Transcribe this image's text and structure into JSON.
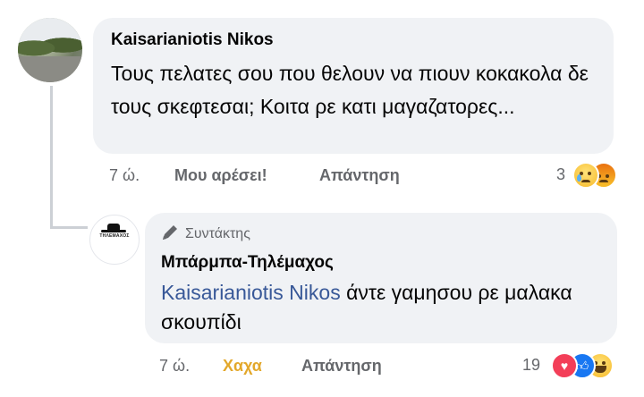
{
  "comment": {
    "author": "Kaisarianiotis Nikos",
    "text": "Τους πελατες σου που θελουν να πιουν κοκακολα δε τους σκεφτεσαι; Κοιτα ρε κατι μαγαζατορες...",
    "time": "7 ώ.",
    "like_label": "Μου αρέσει!",
    "reply_label": "Απάντηση",
    "reaction_count": "3",
    "reactions": [
      "sad-icon",
      "angry-icon"
    ]
  },
  "reply": {
    "badge": "Συντάκτης",
    "author": "Μπάρμπα-Τηλέμαχος",
    "avatar_text": "ΤΗΛΕΜΑΧΟΣ",
    "mention": "Kaisarianiotis Nikos",
    "text": " άντε γαμησου ρε μαλακα σκουπίδι",
    "time": "7 ώ.",
    "like_label": "Χαχα",
    "reply_label": "Απάντηση",
    "reaction_count": "19",
    "reactions": [
      "love-icon",
      "like-icon",
      "haha-icon"
    ]
  },
  "colors": {
    "bubble": "#f0f2f5",
    "meta": "#65676b",
    "mention": "#385898",
    "haha_active": "#e3a82b"
  }
}
